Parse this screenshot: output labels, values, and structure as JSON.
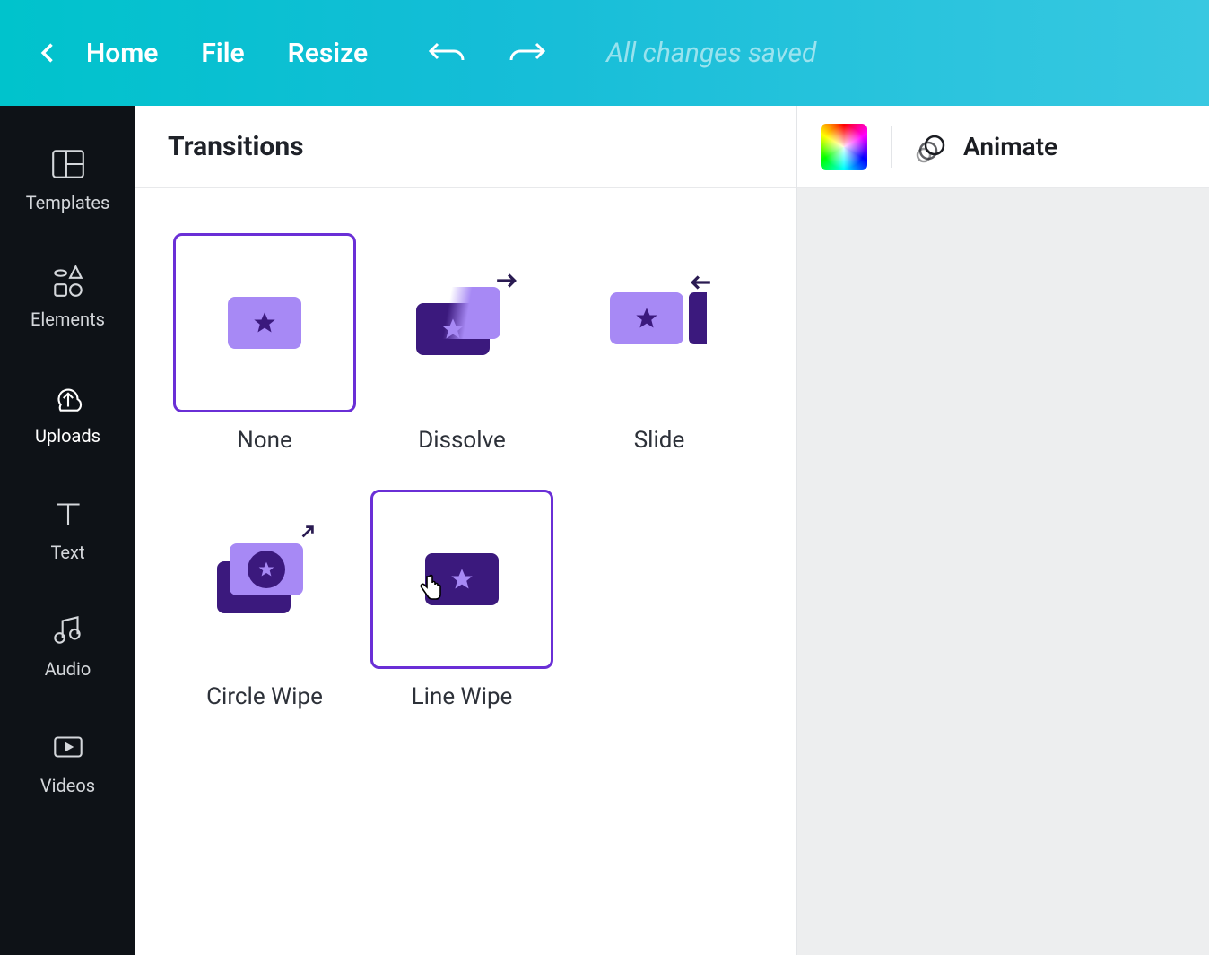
{
  "topbar": {
    "home": "Home",
    "file": "File",
    "resize": "Resize",
    "status": "All changes saved"
  },
  "sidebar": {
    "items": [
      {
        "label": "Templates"
      },
      {
        "label": "Elements"
      },
      {
        "label": "Uploads"
      },
      {
        "label": "Text"
      },
      {
        "label": "Audio"
      },
      {
        "label": "Videos"
      }
    ]
  },
  "panel": {
    "title": "Transitions"
  },
  "transitions": {
    "items": [
      {
        "label": "None"
      },
      {
        "label": "Dissolve"
      },
      {
        "label": "Slide"
      },
      {
        "label": "Circle Wipe"
      },
      {
        "label": "Line Wipe"
      }
    ],
    "selected_index": 0,
    "hovered_index": 4
  },
  "rightbar": {
    "animate": "Animate"
  }
}
